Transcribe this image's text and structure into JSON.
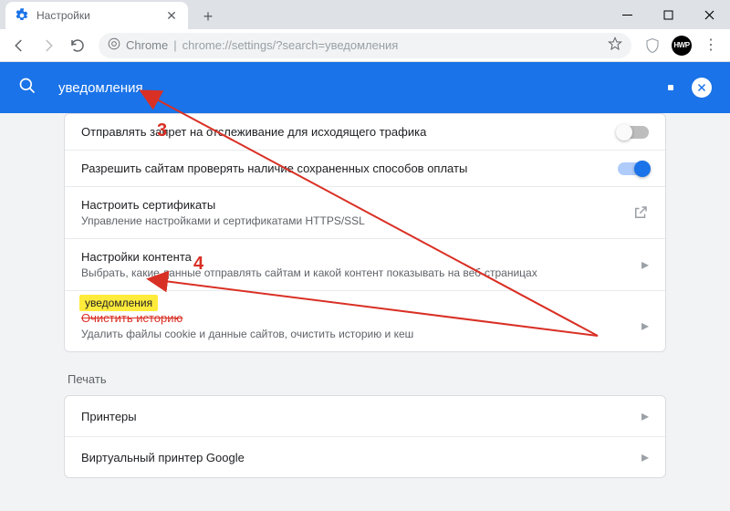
{
  "window": {
    "tab_title": "Настройки",
    "avatar_text": "HWP"
  },
  "omnibox": {
    "prefix": "Chrome",
    "separator": " | ",
    "path": "chrome://settings/?search=уведомления"
  },
  "search": {
    "query": "уведомления"
  },
  "rows": {
    "dnt": {
      "title": "Отправлять запрет на отслеживание для исходящего трафика"
    },
    "payment": {
      "title": "Разрешить сайтам проверять наличие сохраненных способов оплаты"
    },
    "certs": {
      "title": "Настроить сертификаты",
      "sub": "Управление настройками и сертификатами HTTPS/SSL"
    },
    "content": {
      "title": "Настройки контента",
      "sub": "Выбрать, какие данные отправлять сайтам и какой контент показывать на веб-страницах"
    },
    "clear": {
      "title_struck": "Очистить историю",
      "highlight": "уведомления",
      "sub": "Удалить файлы cookie и данные сайтов, очистить историю и кеш"
    }
  },
  "print_section": {
    "label": "Печать",
    "printers": "Принтеры",
    "gcp": "Виртуальный принтер Google"
  },
  "annotations": {
    "num3": "3",
    "num4": "4"
  }
}
